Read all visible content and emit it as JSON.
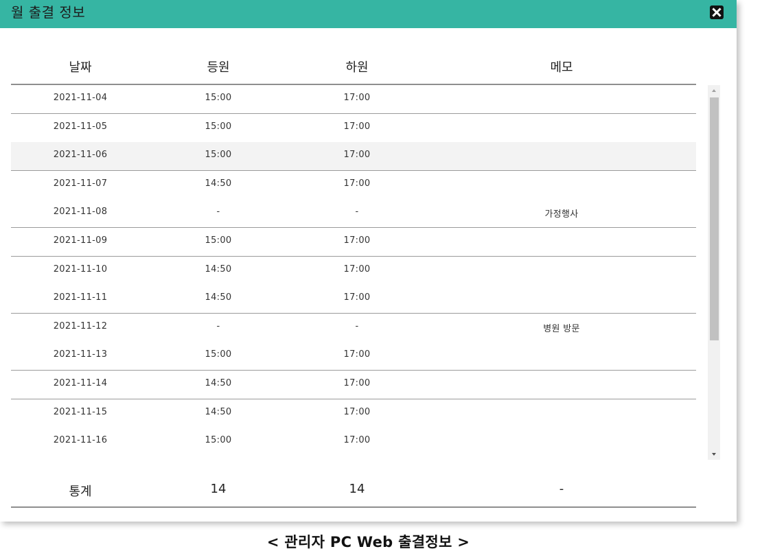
{
  "window": {
    "title": "월 출결 정보",
    "close_icon": "close-x-icon",
    "header_color": "#36b5a3"
  },
  "table": {
    "columns": [
      "날짜",
      "등원",
      "하원",
      "메모"
    ],
    "rows": [
      {
        "date": "2021-11-04",
        "in": "15:00",
        "out": "17:00",
        "memo": ""
      },
      {
        "date": "2021-11-05",
        "in": "15:00",
        "out": "17:00",
        "memo": ""
      },
      {
        "date": "2021-11-06",
        "in": "15:00",
        "out": "17:00",
        "memo": ""
      },
      {
        "date": "2021-11-07",
        "in": "14:50",
        "out": "17:00",
        "memo": ""
      },
      {
        "date": "2021-11-08",
        "in": "-",
        "out": "-",
        "memo": "가정행사"
      },
      {
        "date": "2021-11-09",
        "in": "15:00",
        "out": "17:00",
        "memo": ""
      },
      {
        "date": "2021-11-10",
        "in": "14:50",
        "out": "17:00",
        "memo": ""
      },
      {
        "date": "2021-11-11",
        "in": "14:50",
        "out": "17:00",
        "memo": ""
      },
      {
        "date": "2021-11-12",
        "in": "-",
        "out": "-",
        "memo": "병원 방문"
      },
      {
        "date": "2021-11-13",
        "in": "15:00",
        "out": "17:00",
        "memo": ""
      },
      {
        "date": "2021-11-14",
        "in": "14:50",
        "out": "17:00",
        "memo": ""
      },
      {
        "date": "2021-11-15",
        "in": "14:50",
        "out": "17:00",
        "memo": ""
      },
      {
        "date": "2021-11-16",
        "in": "15:00",
        "out": "17:00",
        "memo": ""
      }
    ],
    "highlighted_row_index": 2
  },
  "stats": {
    "label": "통계",
    "in_count": "14",
    "out_count": "14",
    "memo": "-"
  },
  "caption": "< 관리자 PC Web 출결정보 >"
}
